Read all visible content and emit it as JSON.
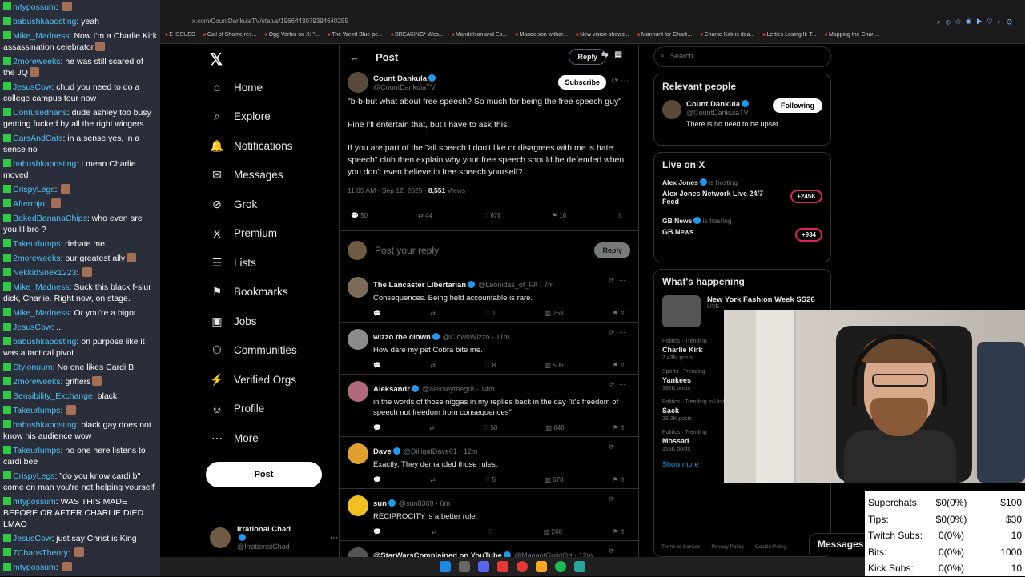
{
  "chat": [
    {
      "user": "mtypossum",
      "text": "",
      "emote": true
    },
    {
      "user": "babushkaposting",
      "text": "yeah",
      "emote": false
    },
    {
      "user": "Mike_Madness",
      "text": "Now I'm a Charlie Kirk assassination celebrator",
      "emote": true
    },
    {
      "user": "2moreweeks",
      "text": "he was still scared of the JQ",
      "emote": true
    },
    {
      "user": "JesusCow",
      "text": "chud you need to do a college campus tour now",
      "emote": false
    },
    {
      "user": "Confusedhans",
      "text": "dude ashley too busy gettting fucked by all the right wingers",
      "emote": false
    },
    {
      "user": "CarsAndCats",
      "text": "in a sense yes, in a sense no",
      "emote": false
    },
    {
      "user": "babushkaposting",
      "text": "I mean Charlie moved",
      "emote": false
    },
    {
      "user": "CrispyLegs",
      "text": "",
      "emote": true
    },
    {
      "user": "Afterrojo",
      "text": "",
      "emote": true
    },
    {
      "user": "BakedBananaChips",
      "text": "who even are you lil bro ?",
      "emote": false
    },
    {
      "user": "Takeurlumps",
      "text": "debate me",
      "emote": false
    },
    {
      "user": "2moreweeks",
      "text": "our greatest ally",
      "emote": true
    },
    {
      "user": "NekkidSnek1223",
      "text": "",
      "emote": true
    },
    {
      "user": "Mike_Madness",
      "text": "Suck this black f-slur dick, Charlie. Right now, on stage.",
      "emote": false
    },
    {
      "user": "Mike_Madness",
      "text": "Or you're a bigot",
      "emote": false
    },
    {
      "user": "JesusCow",
      "text": "...",
      "emote": false
    },
    {
      "user": "babushkaposting",
      "text": "on purpose like it was a tactical pivot",
      "emote": false
    },
    {
      "user": "Stylonuum",
      "text": "No one likes Cardi B",
      "emote": false
    },
    {
      "user": "2moreweeks",
      "text": "grifters",
      "emote": true
    },
    {
      "user": "Sensibility_Exchange",
      "text": "black",
      "emote": false
    },
    {
      "user": "Takeurlumps",
      "text": "",
      "emote": true
    },
    {
      "user": "babushkaposting",
      "text": "black gay does not know his audience wow",
      "emote": false
    },
    {
      "user": "Takeurlumps",
      "text": "no one here listens to cardi bee",
      "emote": false
    },
    {
      "user": "CrispyLegs",
      "text": "\"do you know cardi b\" come on man you're not helping yourself",
      "emote": false
    },
    {
      "user": "mtypossum",
      "text": "WAS THIS MADE BEFORE OR AFTER CHARLIE DIED LMAO",
      "emote": false
    },
    {
      "user": "JesusCow",
      "text": "just say Christ is King",
      "emote": false
    },
    {
      "user": "7ChaosTheory",
      "text": "",
      "emote": true
    },
    {
      "user": "mtypossum",
      "text": "",
      "emote": true
    }
  ],
  "browser": {
    "url": "x.com/CountDankulaTV/status/1966443079394640255",
    "bookmarks": [
      "E ISSUES",
      "Call of Shame res...",
      "Ogg Vorbis on X: \"...",
      "The Weird Blue pe...",
      "BREAKING* Wes...",
      "Mandelson and Ep...",
      "Mandelson withdr...",
      "New vision shows...",
      "Manhunt for Charli...",
      "Charlie Kirk is dea...",
      "Lefties Losing It: T...",
      "Mapping the Charl..."
    ]
  },
  "nav": {
    "items": [
      {
        "label": "Home",
        "icon": "⌂",
        "name": "home"
      },
      {
        "label": "Explore",
        "icon": "⌕",
        "name": "explore"
      },
      {
        "label": "Notifications",
        "icon": "🔔",
        "name": "notifications"
      },
      {
        "label": "Messages",
        "icon": "✉",
        "name": "messages"
      },
      {
        "label": "Grok",
        "icon": "⊘",
        "name": "grok"
      },
      {
        "label": "Premium",
        "icon": "X",
        "name": "premium"
      },
      {
        "label": "Lists",
        "icon": "☰",
        "name": "lists"
      },
      {
        "label": "Bookmarks",
        "icon": "⚑",
        "name": "bookmarks"
      },
      {
        "label": "Jobs",
        "icon": "▣",
        "name": "jobs"
      },
      {
        "label": "Communities",
        "icon": "⚇",
        "name": "communities"
      },
      {
        "label": "Verified Orgs",
        "icon": "⚡",
        "name": "verified-orgs"
      },
      {
        "label": "Profile",
        "icon": "☺",
        "name": "profile"
      },
      {
        "label": "More",
        "icon": "⋯",
        "name": "more"
      }
    ],
    "post_label": "Post",
    "account_name": "Irrational Chad",
    "account_handle": "@IrrationalChad"
  },
  "post": {
    "header_title": "Post",
    "reply_chip": "Reply",
    "author_name": "Count Dankula",
    "author_handle": "@CountDankulaTV",
    "subscribe_label": "Subscribe",
    "paragraphs": [
      "\"b-b-but what about free speech? So much for being the free speech guy\"",
      "Fine I'll entertain that, but I have to ask this.",
      "If you are part of the \"all speech I don't like or disagrees with me is hate speech\" club then explain why your free speech should be defended when you don't even believe in free speech yourself?"
    ],
    "timestamp": "11:05 AM · Sep 12, 2025 · ",
    "views_count": "8,551",
    "views_label": " Views",
    "replies": "50",
    "reposts": "44",
    "likes": "678",
    "bookmarks": "16",
    "reply_placeholder": "Post your reply",
    "reply_button": "Reply"
  },
  "replies": [
    {
      "name": "The Lancaster Libertarian",
      "handle": "@Leonidas_of_PA · 7m",
      "text": "Consequences. Being held accountable is rare.",
      "replies": "",
      "reposts": "",
      "likes": "1",
      "views": "268",
      "color": "#7d6b5a"
    },
    {
      "name": "wizzo the clown",
      "handle": "@ClownWizzo · 11m",
      "text": "How dare my pet Cobra bite me.",
      "replies": "",
      "reposts": "",
      "likes": "8",
      "views": "506",
      "color": "#8c8c8c"
    },
    {
      "name": "Aleksandr",
      "handle": "@alekseythegr8 · 14m",
      "text": "in the words of those niggas in my replies back in the day \"it's freedom of speech not freedom from consequences\"",
      "replies": "",
      "reposts": "",
      "likes": "50",
      "views": "848",
      "color": "#b06a7a"
    },
    {
      "name": "Dave",
      "handle": "@DilligafDave01 · 12m",
      "text": "Exactly. They demanded those rules.",
      "replies": "",
      "reposts": "",
      "likes": "5",
      "views": "678",
      "color": "#e0a030"
    },
    {
      "name": "sun",
      "handle": "@sun8369 · 6m",
      "text": "RECIPROCITY is a better rule.",
      "replies": "",
      "reposts": "",
      "likes": "",
      "views": "260",
      "color": "#f0c020"
    },
    {
      "name": "@StarWarsComplained on YouTube",
      "handle": "@MaggotGuildOrt · 12m",
      "text": "",
      "replies": "",
      "reposts": "",
      "likes": "",
      "views": "",
      "color": "#555"
    }
  ],
  "right": {
    "search_placeholder": "Search",
    "relevant_title": "Relevant people",
    "person_name": "Count Dankula",
    "person_handle": "@CountDankulaTV",
    "person_bio": "There is no need to be upset.",
    "following_label": "Following",
    "live_title": "Live on X",
    "live": [
      {
        "host": "Alex Jones",
        "hosting": " is hosting",
        "title": "Alex Jones Network Live 24/7 Feed",
        "count": "+245K"
      },
      {
        "host": "GB News",
        "hosting": " is hosting",
        "title": "GB News",
        "count": "+934"
      }
    ],
    "happening_title": "What's happening",
    "event_title": "New York Fashion Week SS26",
    "event_live": "LIVE",
    "trends": [
      {
        "cat": "Politics · Trending",
        "name": "Charlie Kirk",
        "posts": "7.43M posts"
      },
      {
        "cat": "Sports · Trending",
        "name": "Yankees",
        "posts": "192K posts"
      },
      {
        "cat": "Politics · Trending in United K",
        "name": "Sack",
        "posts": "28.2K posts"
      },
      {
        "cat": "Politics · Trending",
        "name": "Mossad",
        "posts": "155K posts"
      }
    ],
    "show_more": "Show more",
    "footer": [
      "Terms of Service",
      "Privacy Policy",
      "Cookie Policy"
    ],
    "messages_label": "Messages"
  },
  "stats": [
    {
      "label": "Superchats:",
      "value": "$0(0%)",
      "goal": "$100"
    },
    {
      "label": "Tips:",
      "value": "$0(0%)",
      "goal": "$30"
    },
    {
      "label": "Twitch Subs:",
      "value": "0(0%)",
      "goal": "10"
    },
    {
      "label": "Bits:",
      "value": "0(0%)",
      "goal": "1000"
    },
    {
      "label": "Kick Subs:",
      "value": "0(0%)",
      "goal": "10"
    }
  ]
}
